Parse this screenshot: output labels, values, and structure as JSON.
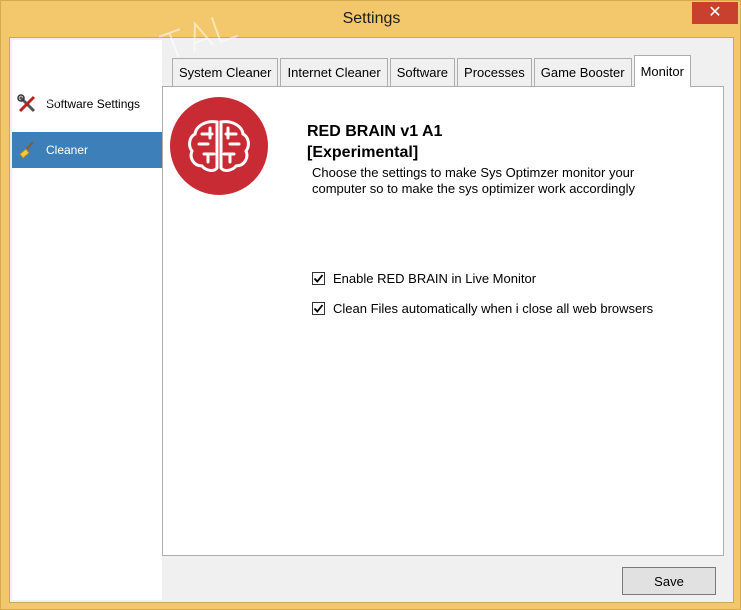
{
  "window": {
    "title": "Settings",
    "close_glyph": "✕"
  },
  "sidebar": {
    "items": [
      {
        "label": "Software Settings",
        "icon": "tools-icon",
        "selected": false
      },
      {
        "label": "Cleaner",
        "icon": "broom-icon",
        "selected": true
      }
    ]
  },
  "tabs": [
    {
      "label": "System Cleaner",
      "active": false
    },
    {
      "label": "Internet Cleaner",
      "active": false
    },
    {
      "label": "Software",
      "active": false
    },
    {
      "label": "Processes",
      "active": false
    },
    {
      "label": "Game Booster",
      "active": false
    },
    {
      "label": "Monitor",
      "active": true
    }
  ],
  "monitor": {
    "logo_icon": "brain-icon",
    "title_line1": "RED BRAIN v1 A1",
    "title_line2": "[Experimental]",
    "description": "Choose the settings to make Sys Optimzer monitor your computer so to make the sys optimizer work accordingly",
    "options": [
      {
        "label": "Enable RED BRAIN in Live Monitor",
        "checked": true
      },
      {
        "label": "Clean Files automatically when i close all web browsers",
        "checked": true
      }
    ]
  },
  "footer": {
    "save_label": "Save"
  },
  "colors": {
    "frame": "#f3c76b",
    "close_button": "#c7412e",
    "selected_item": "#3d7fb9",
    "logo": "#c92b35"
  }
}
